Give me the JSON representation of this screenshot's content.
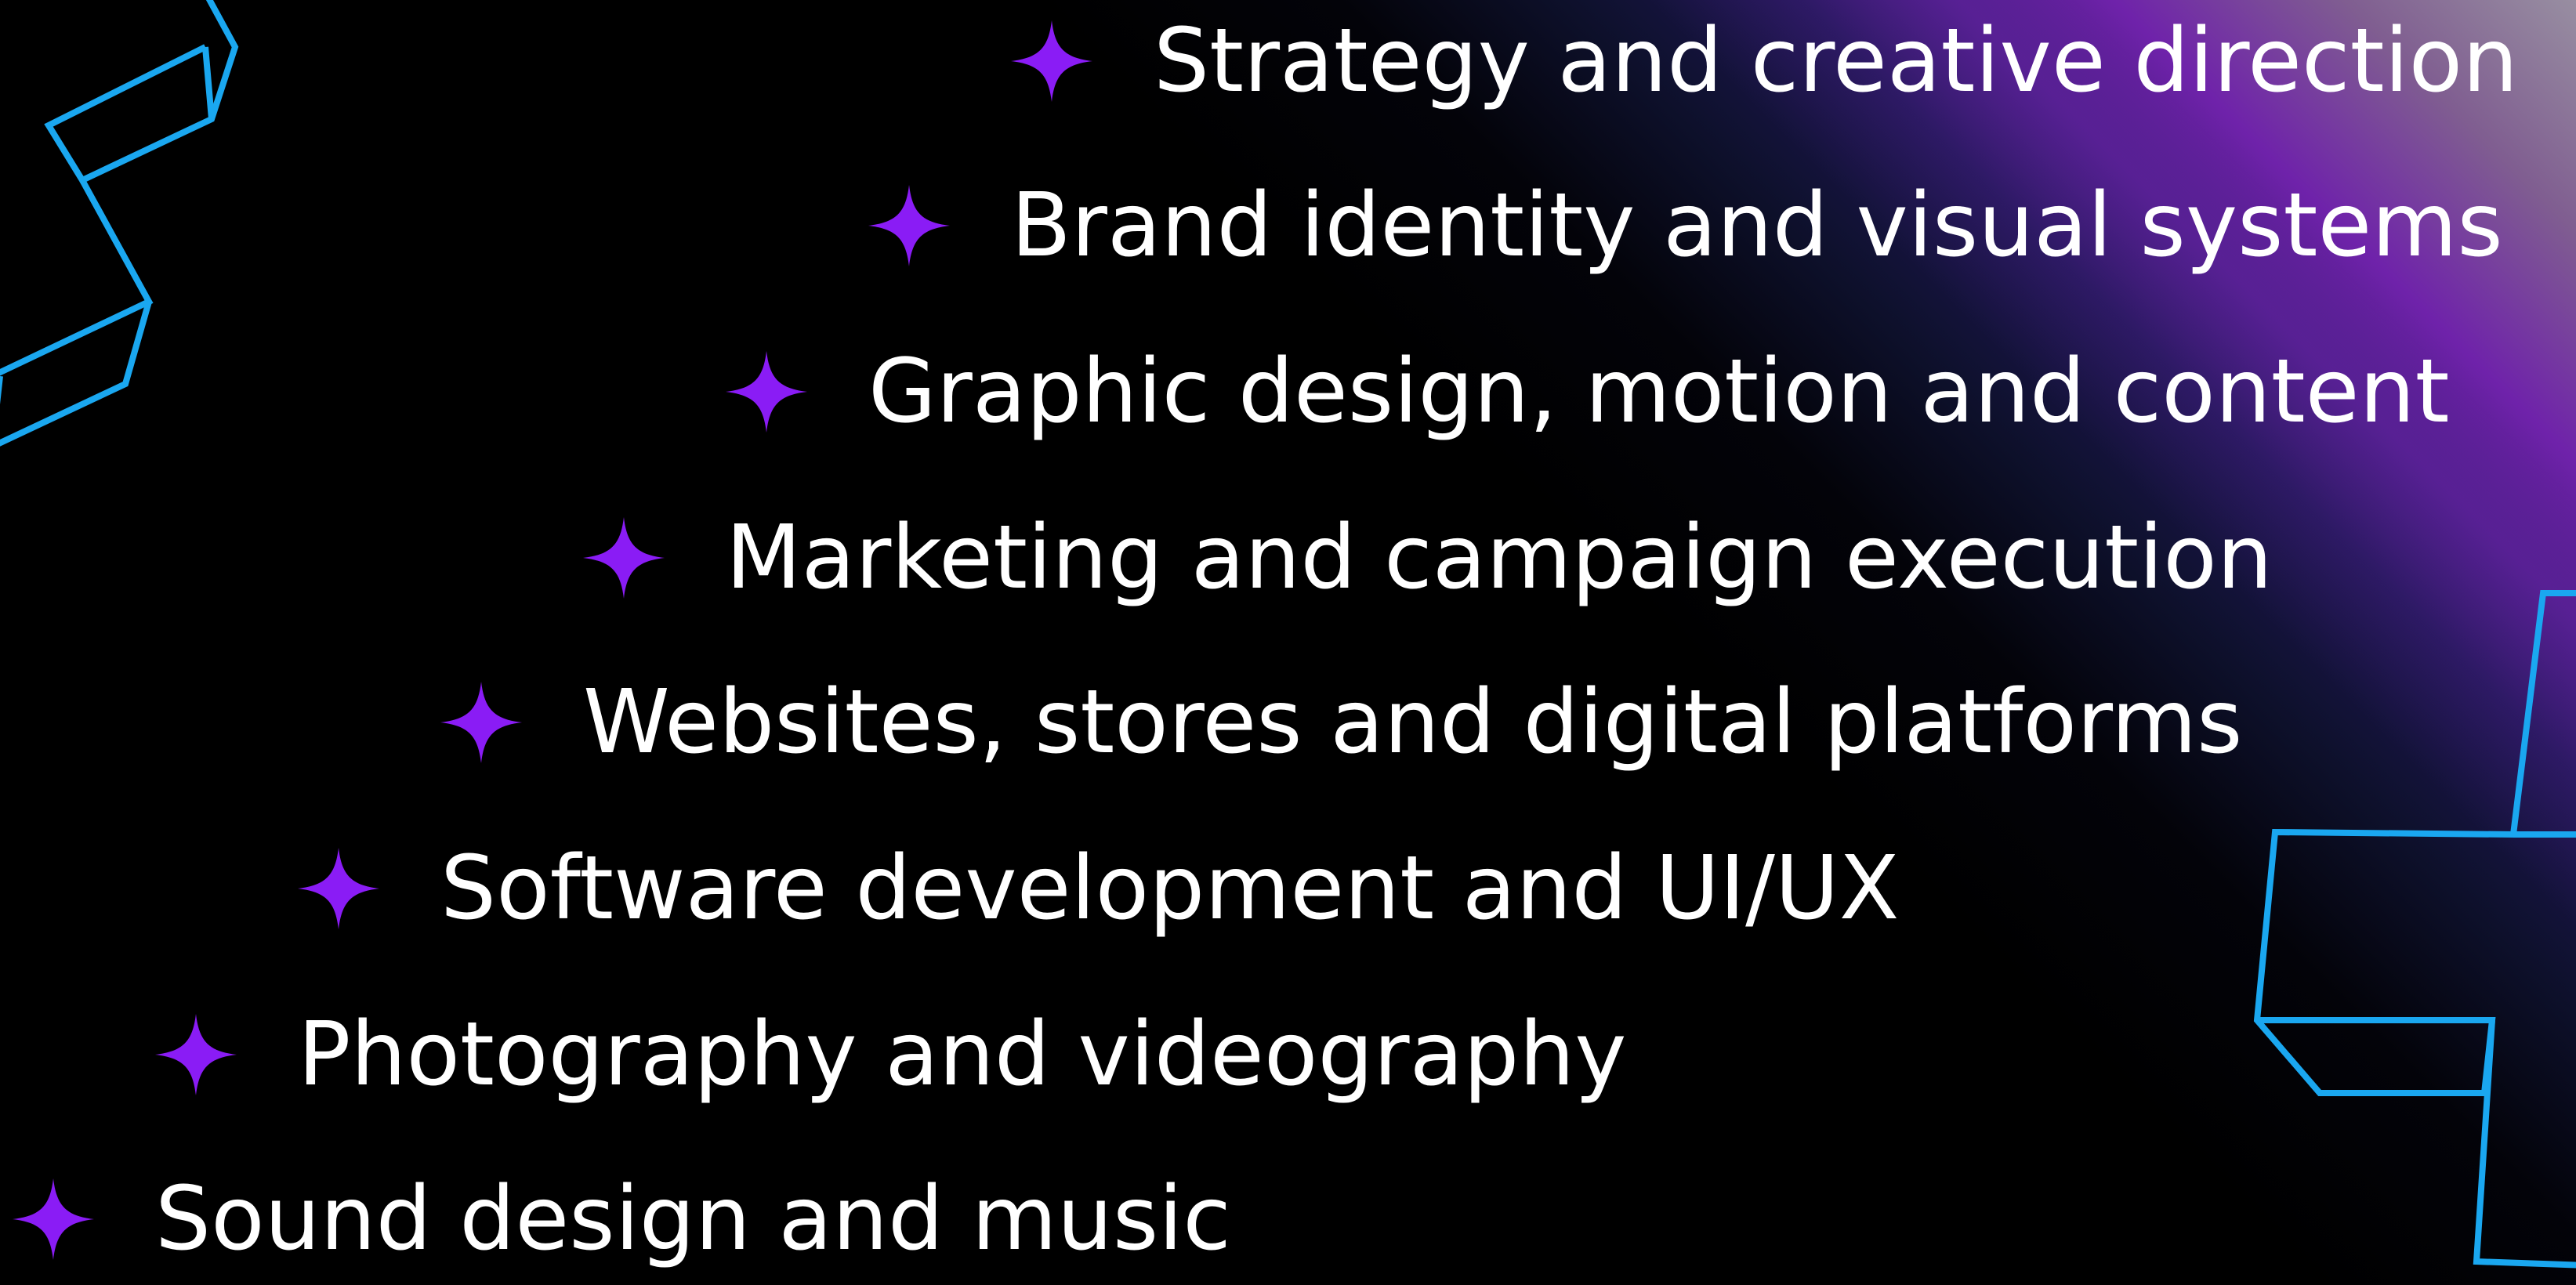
{
  "colors": {
    "background": "#000000",
    "text": "#ffffff",
    "star": "#8a1cf5",
    "outline": "#1aa7f0",
    "beam": "#8a2be2"
  },
  "icons": {
    "bullet": "four-point-star-icon"
  },
  "services": [
    {
      "label": "Strategy and creative direction"
    },
    {
      "label": "Brand identity and visual systems"
    },
    {
      "label": "Graphic design, motion and content"
    },
    {
      "label": "Marketing and campaign execution"
    },
    {
      "label": "Websites, stores and digital platforms"
    },
    {
      "label": "Software development and UI/UX"
    },
    {
      "label": "Photography and videography"
    },
    {
      "label": "Sound design and music"
    }
  ]
}
